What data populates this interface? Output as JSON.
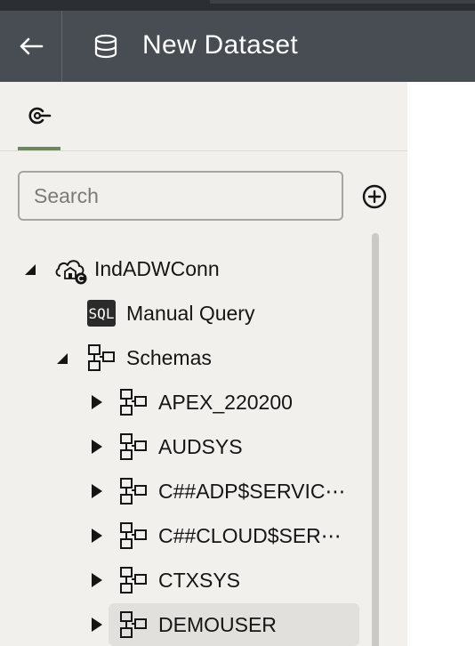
{
  "header": {
    "back_icon": "arrow-left-icon",
    "dataset_icon": "database-icon",
    "title": "New Dataset"
  },
  "tabs": [
    {
      "icon": "connection-icon",
      "active": true
    }
  ],
  "search": {
    "placeholder": "Search",
    "value": ""
  },
  "add_icon": "plus-circle-icon",
  "colors": {
    "header_bg": "#474d52",
    "panel_bg": "#f1f0ed",
    "tab_accent": "#6b8a5b",
    "selected_bg": "#e2e0dc"
  },
  "tree": {
    "connection": {
      "label": "IndADWConn",
      "icon": "cloud-connection-icon",
      "expanded": true
    },
    "manual_query": {
      "label": "Manual Query",
      "icon": "sql-icon",
      "badge": "SQL"
    },
    "schemas": {
      "label": "Schemas",
      "icon": "schema-icon",
      "expanded": true
    },
    "schema_items": [
      {
        "label": "APEX_220200",
        "icon": "schema-icon",
        "expanded": false,
        "selected": false
      },
      {
        "label": "AUDSYS",
        "icon": "schema-icon",
        "expanded": false,
        "selected": false
      },
      {
        "label": "C##ADP$SERVIC⋯",
        "icon": "schema-icon",
        "expanded": false,
        "selected": false
      },
      {
        "label": "C##CLOUD$SER⋯",
        "icon": "schema-icon",
        "expanded": false,
        "selected": false
      },
      {
        "label": "CTXSYS",
        "icon": "schema-icon",
        "expanded": false,
        "selected": false
      },
      {
        "label": "DEMOUSER",
        "icon": "schema-icon",
        "expanded": false,
        "selected": true
      }
    ]
  }
}
